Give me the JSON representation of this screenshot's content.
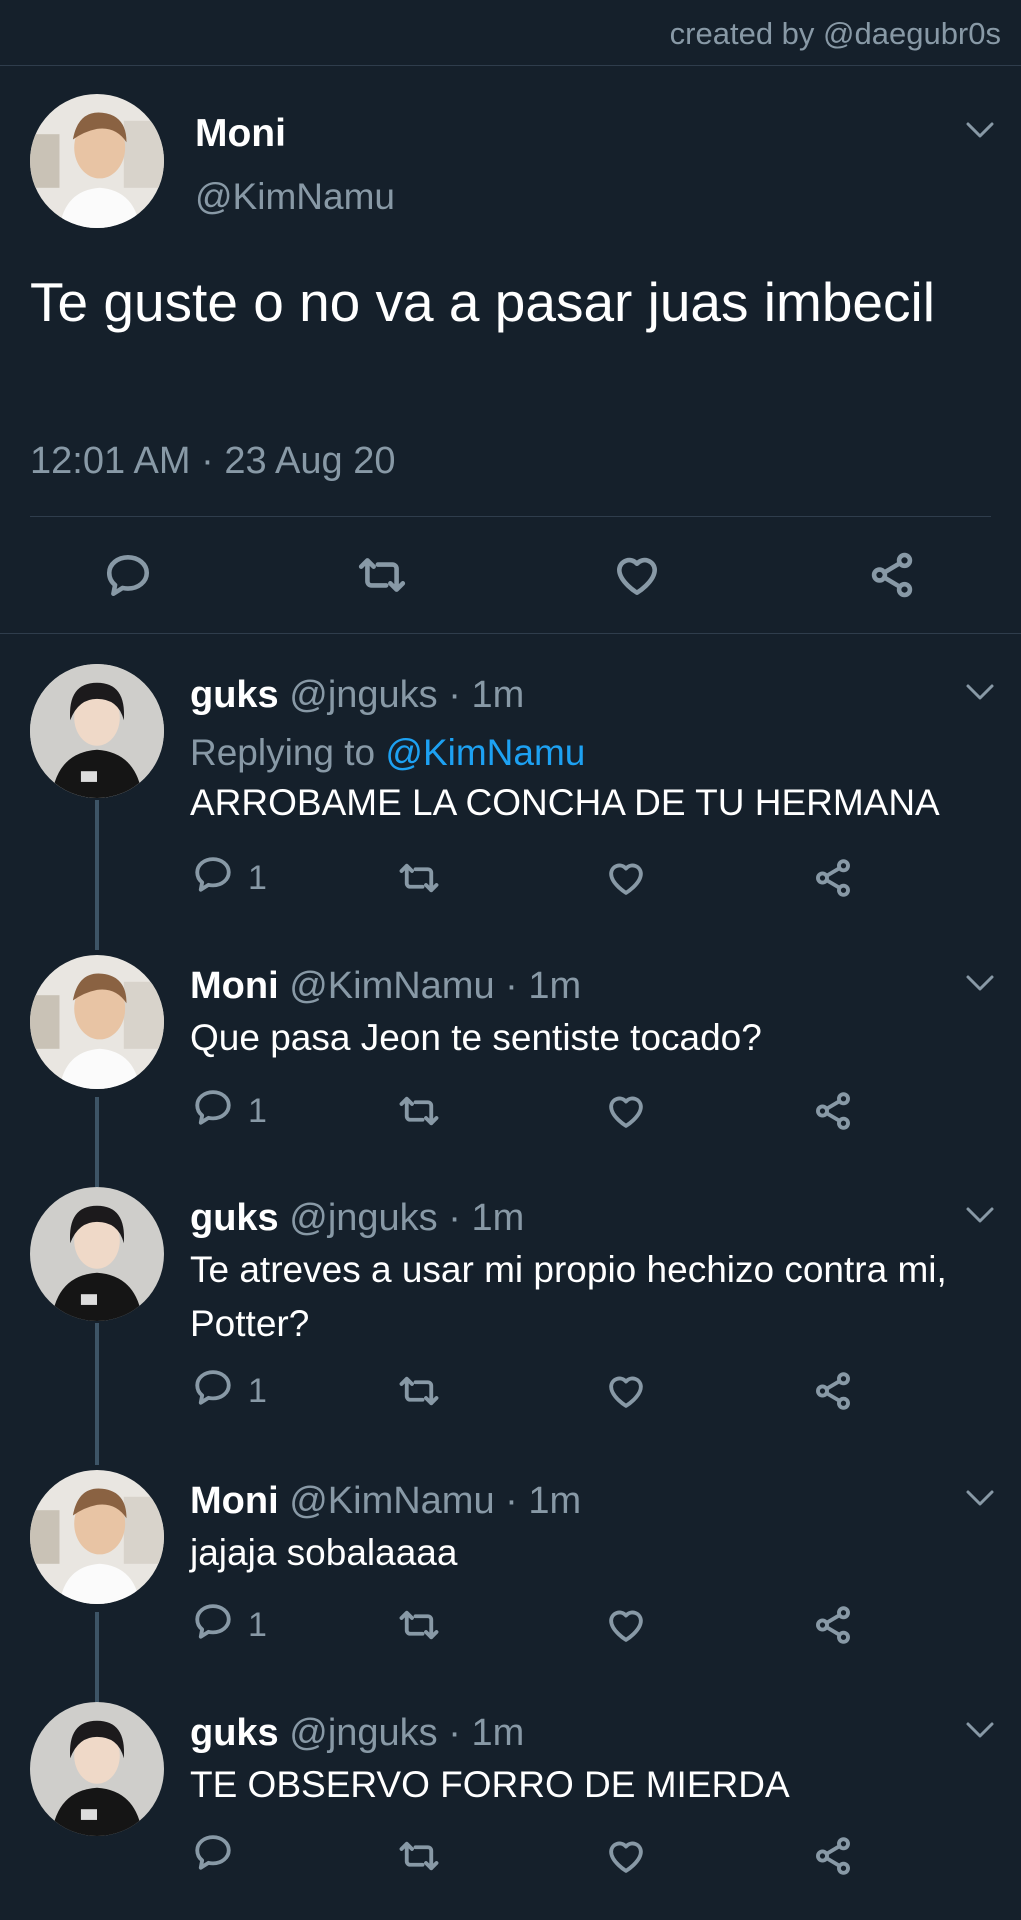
{
  "credit": "created by @daegubr0s",
  "main_tweet": {
    "name": "Moni",
    "handle": "@KimNamu",
    "text": "Te guste o no va a pasar juas imbecil",
    "timestamp": "12:01 AM · 23 Aug 20"
  },
  "replies": [
    {
      "name": "guks",
      "meta": "@jnguks · 1m",
      "replying_label": "Replying to",
      "replying_to": "@KimNamu",
      "text": "ARROBAME LA CONCHA DE TU HERMANA",
      "reply_count": "1"
    },
    {
      "name": "Moni",
      "meta": "@KimNamu · 1m",
      "text": "Que pasa Jeon te sentiste tocado?",
      "reply_count": "1"
    },
    {
      "name": "guks",
      "meta": "@jnguks · 1m",
      "text": "Te atreves a usar mi propio hechizo contra mi, Potter?",
      "reply_count": "1"
    },
    {
      "name": "Moni",
      "meta": "@KimNamu · 1m",
      "text": "jajaja sobalaaaa",
      "reply_count": "1"
    },
    {
      "name": "guks",
      "meta": "@jnguks · 1m",
      "text": "TE OBSERVO FORRO DE MIERDA",
      "reply_count": ""
    }
  ],
  "colors": {
    "background": "#15202b",
    "secondary_text": "#8899a6",
    "mention": "#1da1f2",
    "divider": "#2f3d4c",
    "thread_line": "#3d5466"
  },
  "icons": [
    "chevron-down-icon",
    "reply-icon",
    "retweet-icon",
    "like-icon",
    "share-icon"
  ]
}
